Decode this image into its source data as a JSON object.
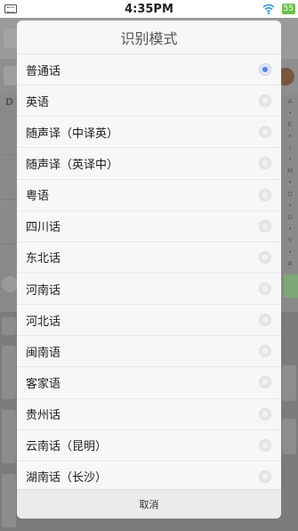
{
  "status_bar": {
    "time": "4:35PM",
    "battery": "55",
    "icons": [
      "keyboard-icon",
      "wifi-icon",
      "battery-icon"
    ]
  },
  "background": {
    "section_letter": "D",
    "index_letters": [
      "A",
      "•",
      "E",
      "•",
      "I",
      "•",
      "M",
      "•",
      "Q",
      "•",
      "U",
      "•",
      "Y",
      "•",
      "#"
    ]
  },
  "dialog": {
    "title": "识别模式",
    "selected_index": 0,
    "options": [
      {
        "label": "普通话"
      },
      {
        "label": "英语"
      },
      {
        "label": "随声译（中译英）"
      },
      {
        "label": "随声译（英译中）"
      },
      {
        "label": "粤语"
      },
      {
        "label": "四川话"
      },
      {
        "label": "东北话"
      },
      {
        "label": "河南话"
      },
      {
        "label": "河北话"
      },
      {
        "label": "闽南语"
      },
      {
        "label": "客家语"
      },
      {
        "label": "贵州话"
      },
      {
        "label": "云南话（昆明）"
      },
      {
        "label": "湖南话（长沙）"
      }
    ],
    "cancel_label": "取消"
  },
  "colors": {
    "radio_selected": "#5b84e0",
    "battery": "#6cc04a"
  }
}
